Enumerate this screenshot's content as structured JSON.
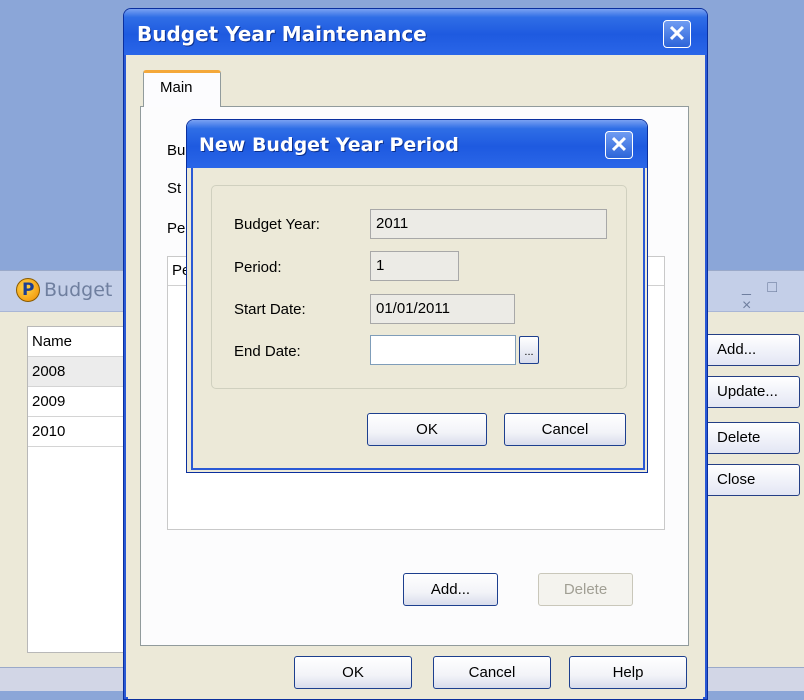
{
  "background_window": {
    "title": "Budget",
    "list_header": "Name",
    "rows": [
      "2008",
      "2009",
      "2010"
    ],
    "buttons": {
      "add": "Add...",
      "update": "Update...",
      "delete": "Delete",
      "close": "Close"
    }
  },
  "maintenance_dialog": {
    "title": "Budget Year Maintenance",
    "tab": "Main",
    "hidden_labels": [
      "Bu",
      "St",
      "Pe"
    ],
    "grid_header": "Pe",
    "buttons": {
      "add": "Add...",
      "delete": "Delete",
      "ok": "OK",
      "cancel": "Cancel",
      "help": "Help"
    }
  },
  "period_dialog": {
    "title": "New Budget Year Period",
    "fields": {
      "budget_year": {
        "label": "Budget Year:",
        "value": "2011"
      },
      "period": {
        "label": "Period:",
        "value": "1"
      },
      "start_date": {
        "label": "Start Date:",
        "value": "01/01/2011"
      },
      "end_date": {
        "label": "End Date:",
        "value": ""
      }
    },
    "picker_label": "...",
    "buttons": {
      "ok": "OK",
      "cancel": "Cancel"
    }
  },
  "icons": {
    "close": "close-icon",
    "logo": "app-logo-icon"
  },
  "colors": {
    "titlebar": "#1e5ae0",
    "window_bg": "#ece9d8",
    "desktop": "#8ba6d8"
  }
}
